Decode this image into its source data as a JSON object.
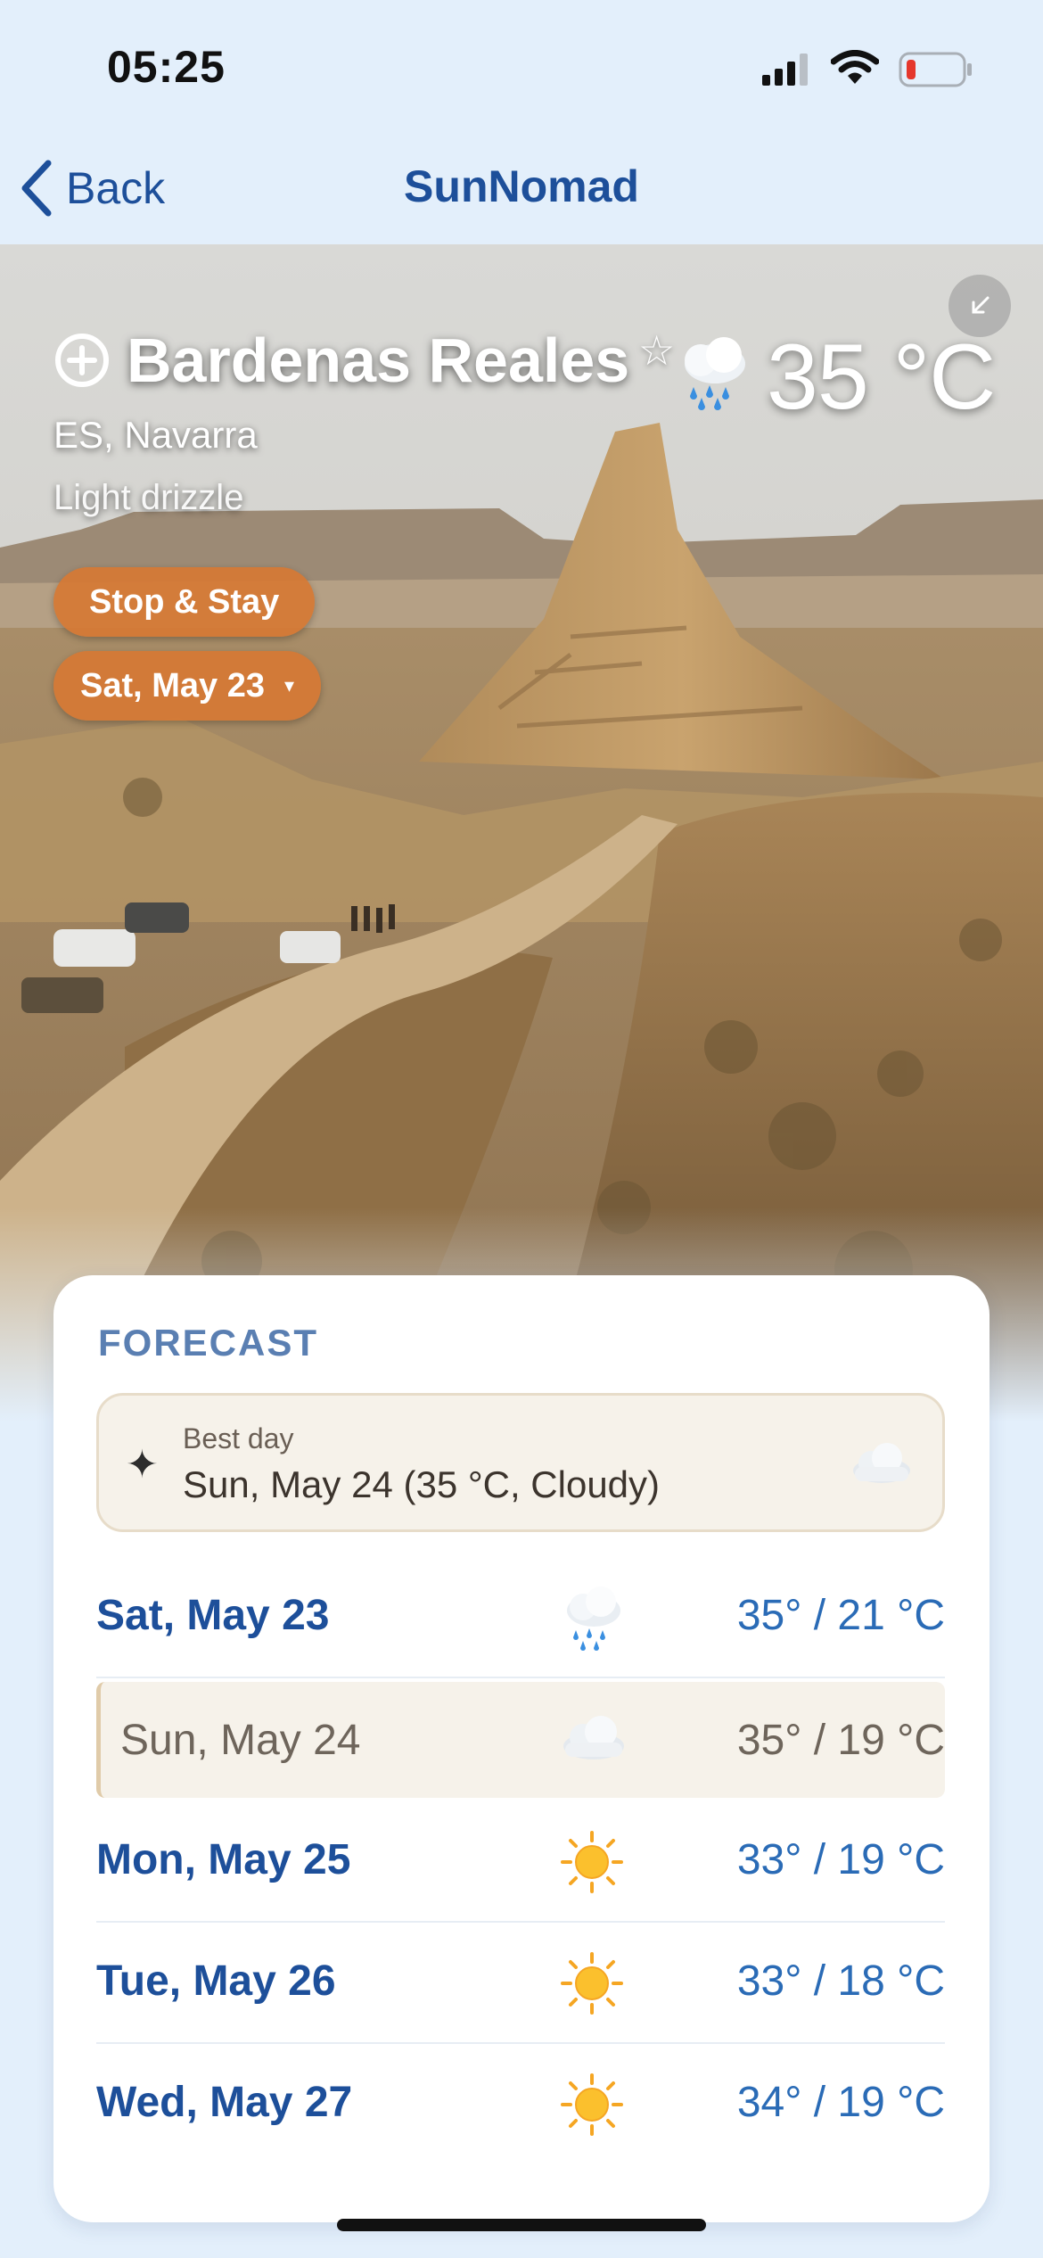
{
  "status_bar": {
    "time": "05:25",
    "signal_icon": "cellular-signal-icon",
    "wifi_icon": "wifi-icon",
    "battery_icon": "battery-low-icon",
    "battery_color": "#e5372c"
  },
  "nav": {
    "back_label": "Back",
    "title": "SunNomad"
  },
  "location": {
    "name": "Bardenas Reales",
    "region": "ES, Navarra",
    "condition": "Light drizzle",
    "current_temp": "35 °C",
    "weather_icon": "rain-cloud-icon",
    "favorite_icon": "☆"
  },
  "actions": {
    "stay_label": "Stop & Stay",
    "date_label": "Sat, May 23",
    "date_caret": "▾"
  },
  "forecast": {
    "heading": "FORECAST",
    "best_day": {
      "icon": "✦",
      "label": "Best day",
      "value": "Sun, May 24 (35 °C, Cloudy)",
      "weather_icon": "cloud-icon"
    },
    "days": [
      {
        "day": "Sat, May 23",
        "icon": "rain-cloud-icon",
        "temp": "35° / 21 °C",
        "selected": false
      },
      {
        "day": "Sun, May 24",
        "icon": "cloud-icon",
        "temp": "35° / 19 °C",
        "selected": true
      },
      {
        "day": "Mon, May 25",
        "icon": "sun-icon",
        "temp": "33° / 19 °C",
        "selected": false
      },
      {
        "day": "Tue, May 26",
        "icon": "sun-icon",
        "temp": "33° / 18 °C",
        "selected": false
      },
      {
        "day": "Wed, May 27",
        "icon": "sun-icon",
        "temp": "34° / 19 °C",
        "selected": false
      }
    ]
  },
  "colors": {
    "background": "#e3effb",
    "brand_blue": "#1d4f9a",
    "temp_blue": "#2a6bb6",
    "accent_orange": "#d67834",
    "best_day_bg": "#f6f2ea"
  }
}
